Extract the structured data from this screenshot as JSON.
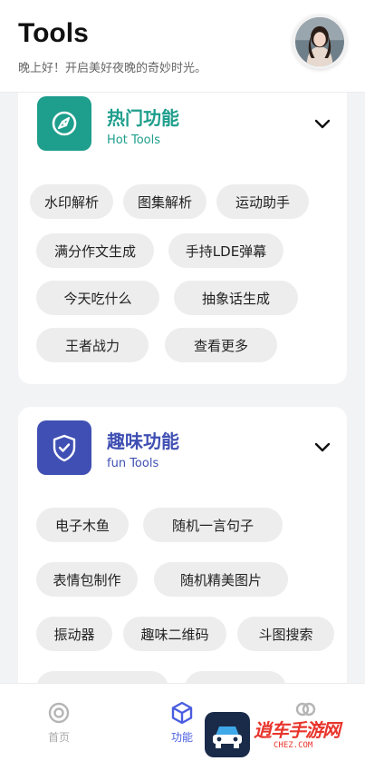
{
  "header": {
    "title": "Tools",
    "greeting": "晚上好！开启美好夜晚的奇妙时光。"
  },
  "categories": [
    {
      "title": "热门功能",
      "subtitle": "Hot Tools",
      "icon": "compass-icon",
      "color": "#1e9e8c",
      "tools": [
        "水印解析",
        "图集解析",
        "运动助手",
        "满分作文生成",
        "手持LDE弹幕",
        "今天吃什么",
        "抽象话生成",
        "王者战力",
        "查看更多"
      ]
    },
    {
      "title": "趣味功能",
      "subtitle": "fun Tools",
      "icon": "shield-check-icon",
      "color": "#3f4fb3",
      "tools": [
        "电子木鱼",
        "随机一言句子",
        "表情包制作",
        "随机精美图片",
        "振动器",
        "趣味二维码",
        "斗图搜索"
      ]
    }
  ],
  "bottom_nav": [
    {
      "label": "首页",
      "icon": "home-icon",
      "active": false
    },
    {
      "label": "功能",
      "icon": "cube-icon",
      "active": true
    },
    {
      "label": "",
      "icon": "user-icon",
      "active": false
    }
  ],
  "watermark": {
    "text": "逍车手游网",
    "url": "CHEZ.COM"
  },
  "colors": {
    "accent": "#4a5de0",
    "hot": "#1e9e8c",
    "fun": "#3f4fb3"
  }
}
